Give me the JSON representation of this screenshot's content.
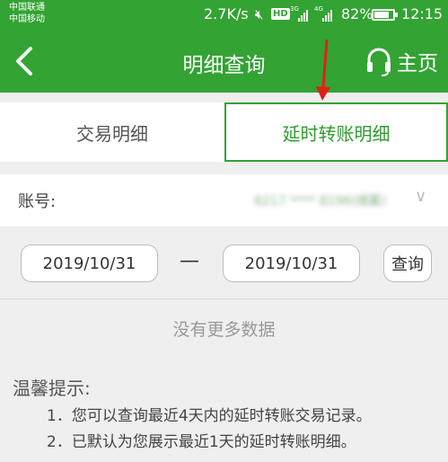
{
  "status_bar": {
    "carrier_1": "中国联通",
    "carrier_2": "中国移动",
    "net_speed": "2.7K/s",
    "hd_label": "HD",
    "network_1": "3G",
    "network_2": "4G",
    "battery_percent": "82%",
    "battery_level": 0.82,
    "time": "12:15",
    "icons": [
      "mute-icon",
      "hd-icon",
      "signal-icon",
      "battery-icon"
    ]
  },
  "nav": {
    "back_icon": "chevron-left-icon",
    "title": "明细查询",
    "home_icon": "headset-icon",
    "home_label": "主页"
  },
  "tabs": [
    {
      "label": "交易明细",
      "active": false
    },
    {
      "label": "延时转账明细",
      "active": true
    }
  ],
  "account": {
    "label": "账号:",
    "value": "6217 **** 8196(储蓄)",
    "dropdown_icon": "chevron-down-icon"
  },
  "date_range": {
    "start": "2019/10/31",
    "separator": "—",
    "end": "2019/10/31",
    "query_label": "查询"
  },
  "empty_message": "没有更多数据",
  "tips": {
    "title": "温馨提示:",
    "items": [
      "1．您可以查询最近4天内的延时转账交易记录。",
      "2．已默认为您展示最近1天的延时转账明细。"
    ]
  },
  "colors": {
    "brand_green": "#33a333",
    "annotation_red": "#e0201b"
  }
}
